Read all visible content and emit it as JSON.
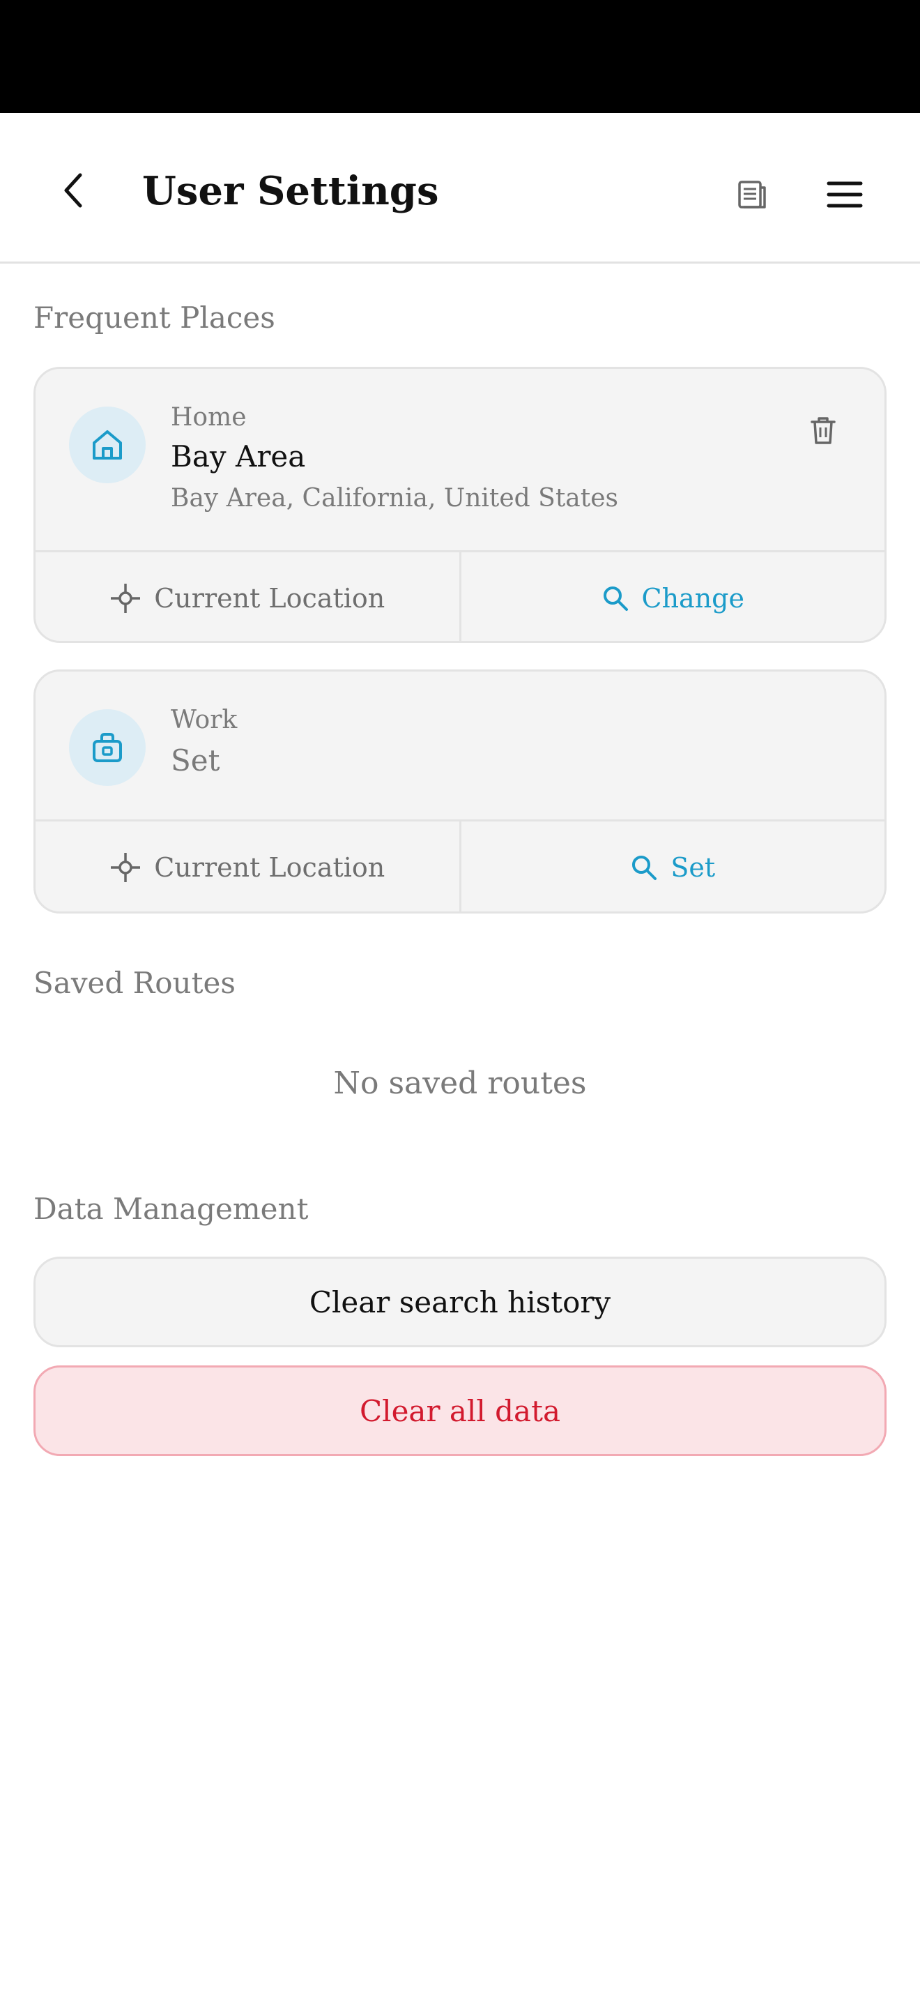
{
  "header": {
    "title": "User Settings",
    "back_icon": "chevron-left-icon",
    "doc_icon": "document-icon",
    "menu_icon": "hamburger-menu-icon"
  },
  "frequent_places": {
    "section_title": "Frequent Places",
    "home": {
      "label": "Home",
      "name": "Bay Area",
      "address": "Bay Area, California, United States",
      "icon": "home-icon",
      "delete_icon": "trash-icon",
      "current_location_label": "Current Location",
      "change_label": "Change"
    },
    "work": {
      "label": "Work",
      "name": "Set",
      "icon": "briefcase-icon",
      "current_location_label": "Current Location",
      "set_label": "Set"
    }
  },
  "saved_routes": {
    "section_title": "Saved Routes",
    "empty_text": "No saved routes"
  },
  "data_management": {
    "section_title": "Data Management",
    "clear_history_label": "Clear search history",
    "clear_all_label": "Clear all data"
  },
  "colors": {
    "accent": "#1b9bc9",
    "danger": "#d21a2e",
    "danger_bg": "#fbe4e7",
    "card_bg": "#f4f4f4",
    "icon_circle_bg": "#ddedf5"
  }
}
